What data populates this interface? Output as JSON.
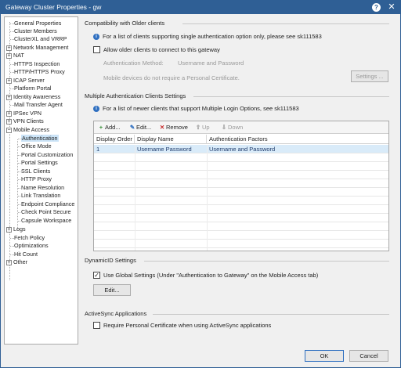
{
  "window": {
    "title": "Gateway Cluster Properties - gw",
    "help": "?",
    "close": "✕"
  },
  "tree": {
    "items": [
      {
        "label": "General Properties",
        "expander": ""
      },
      {
        "label": "Cluster Members",
        "expander": ""
      },
      {
        "label": "ClusterXL and VRRP",
        "expander": ""
      },
      {
        "label": "Network Management",
        "expander": "+"
      },
      {
        "label": "NAT",
        "expander": "+"
      },
      {
        "label": "HTTPS Inspection",
        "expander": ""
      },
      {
        "label": "HTTP/HTTPS Proxy",
        "expander": ""
      },
      {
        "label": "ICAP Server",
        "expander": "+"
      },
      {
        "label": "Platform Portal",
        "expander": ""
      },
      {
        "label": "Identity Awareness",
        "expander": "+"
      },
      {
        "label": "Mail Transfer Agent",
        "expander": ""
      },
      {
        "label": "IPSec VPN",
        "expander": "+"
      },
      {
        "label": "VPN Clients",
        "expander": "+"
      },
      {
        "label": "Mobile Access",
        "expander": "−"
      },
      {
        "label": "Authentication",
        "expander": ""
      },
      {
        "label": "Office Mode",
        "expander": ""
      },
      {
        "label": "Portal Customization",
        "expander": ""
      },
      {
        "label": "Portal Settings",
        "expander": ""
      },
      {
        "label": "SSL Clients",
        "expander": ""
      },
      {
        "label": "HTTP Proxy",
        "expander": ""
      },
      {
        "label": "Name Resolution",
        "expander": ""
      },
      {
        "label": "Link Translation",
        "expander": ""
      },
      {
        "label": "Endpoint Compliance",
        "expander": ""
      },
      {
        "label": "Check Point Secure",
        "expander": ""
      },
      {
        "label": "Capsule Workspace",
        "expander": ""
      },
      {
        "label": "Logs",
        "expander": "+"
      },
      {
        "label": "Fetch Policy",
        "expander": ""
      },
      {
        "label": "Optimizations",
        "expander": ""
      },
      {
        "label": "Hit Count",
        "expander": ""
      },
      {
        "label": "Other",
        "expander": "+"
      }
    ]
  },
  "compat": {
    "title": "Compatibility with Older clients",
    "info": "For a list of clients supporting single authentication option only, please see sk111583",
    "allow_label": "Allow older clients to connect to this gateway",
    "allow_checked": false,
    "auth_method_label": "Authentication Method:",
    "auth_method_value": "Username and Password",
    "mobile_note": "Mobile devices do not require a Personal Certificate.",
    "settings_button": "Settings ..."
  },
  "multi": {
    "title": "Multiple Authentication Clients Settings",
    "info": "For a list of newer clients that support Multiple Login Options, see sk111583",
    "toolbar": {
      "add": "Add...",
      "edit": "Edit...",
      "remove": "Remove",
      "up": "Up",
      "down": "Down"
    },
    "columns": [
      "Display Order",
      "Display Name",
      "Authentication Factors"
    ],
    "rows": [
      {
        "order": "1",
        "name": "Username Password",
        "factors": "Username and Password"
      }
    ]
  },
  "dynamic": {
    "title": "DynamicID Settings",
    "use_global_label": "Use Global Settings (Under \"Authentication to Gateway\" on the Mobile Access tab)",
    "use_global_checked": true,
    "edit_button": "Edit..."
  },
  "activesync": {
    "title": "ActiveSync Applications",
    "require_cert_label": "Require Personal Certificate when using ActiveSync applications",
    "require_cert_checked": false
  },
  "footer": {
    "ok": "OK",
    "cancel": "Cancel"
  },
  "colors": {
    "titlebar": "#2f5f95",
    "selection": "#cce4f7",
    "row_selection": "#d9ebf9"
  }
}
